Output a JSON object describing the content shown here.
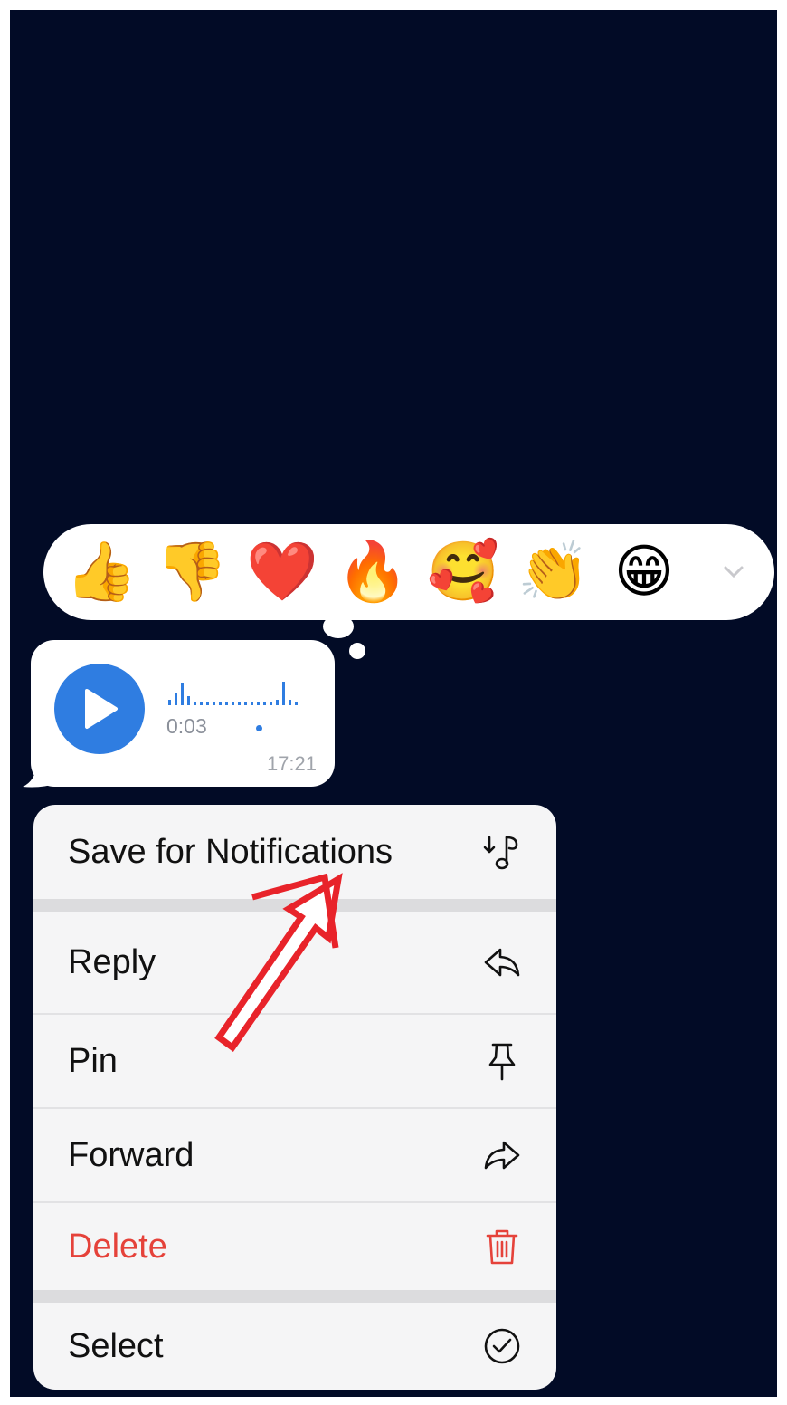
{
  "reactions": [
    {
      "emoji": "👍",
      "icon": "thumbs-up-icon"
    },
    {
      "emoji": "👎",
      "icon": "thumbs-down-icon"
    },
    {
      "emoji": "❤️",
      "icon": "heart-icon"
    },
    {
      "emoji": "🔥",
      "icon": "fire-icon"
    },
    {
      "emoji": "🥰",
      "icon": "smiling-face-hearts-icon"
    },
    {
      "emoji": "👏",
      "icon": "clapping-hands-icon"
    },
    {
      "emoji": "😁",
      "icon": "grinning-face-icon"
    }
  ],
  "voice_message": {
    "duration": "0:03",
    "time": "17:21",
    "accent_color": "#2f7de1"
  },
  "menu": {
    "save_for_notifications": "Save for Notifications",
    "reply": "Reply",
    "pin": "Pin",
    "forward": "Forward",
    "delete": "Delete",
    "select": "Select",
    "danger_color": "#e5423a"
  },
  "annotation_color": "#e8232a"
}
